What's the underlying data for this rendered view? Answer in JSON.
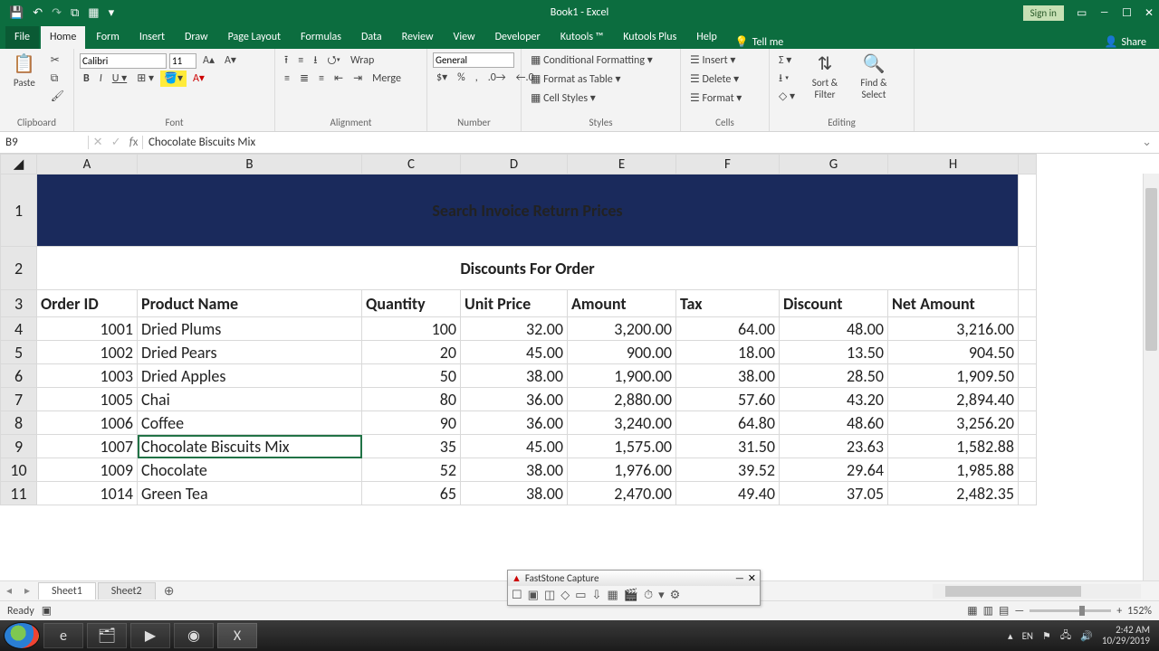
{
  "title": "Book1 - Excel",
  "qat_icons": [
    "save",
    "undo",
    "redo",
    "touch-mouse",
    "table-quick"
  ],
  "signin_label": "Sign in",
  "tabs": [
    "File",
    "Home",
    "Form",
    "Insert",
    "Draw",
    "Page Layout",
    "Formulas",
    "Data",
    "Review",
    "View",
    "Developer",
    "Kutools ™",
    "Kutools Plus",
    "Help"
  ],
  "active_tab": "Home",
  "tellme_label": "Tell me",
  "share_label": "Share",
  "ribbon": {
    "clipboard_label": "Clipboard",
    "paste_label": "Paste",
    "font_label": "Font",
    "font_name": "Calibri",
    "font_size": "11",
    "alignment_label": "Alignment",
    "wrap_label": "Wrap",
    "merge_label": "Merge",
    "number_label": "Number",
    "number_format": "General",
    "styles_label": "Styles",
    "cond_fmt": "Conditional Formatting",
    "fmt_table": "Format as Table",
    "cell_styles": "Cell Styles",
    "cells_label": "Cells",
    "insert": "Insert",
    "delete": "Delete",
    "format": "Format",
    "editing_label": "Editing",
    "sort_filter": "Sort & Filter",
    "find_select": "Find & Select"
  },
  "namebox": "B9",
  "formula_value": "Chocolate Biscuits Mix",
  "columns": [
    "A",
    "B",
    "C",
    "D",
    "E",
    "F",
    "G",
    "H"
  ],
  "banner_text": "Search Invoice Return Prices",
  "subtitle_text": "Discounts For Order",
  "headers": {
    "A": "Order ID",
    "B": "Product Name",
    "C": "Quantity",
    "D": "Unit Price",
    "E": "Amount",
    "F": "Tax",
    "G": "Discount",
    "H": "Net Amount"
  },
  "rows": [
    {
      "n": "4",
      "A": "1001",
      "B": "Dried Plums",
      "C": "100",
      "D": "32.00",
      "E": "3,200.00",
      "F": "64.00",
      "G": "48.00",
      "H": "3,216.00"
    },
    {
      "n": "5",
      "A": "1002",
      "B": "Dried Pears",
      "C": "20",
      "D": "45.00",
      "E": "900.00",
      "F": "18.00",
      "G": "13.50",
      "H": "904.50"
    },
    {
      "n": "6",
      "A": "1003",
      "B": "Dried Apples",
      "C": "50",
      "D": "38.00",
      "E": "1,900.00",
      "F": "38.00",
      "G": "28.50",
      "H": "1,909.50"
    },
    {
      "n": "7",
      "A": "1005",
      "B": "Chai",
      "C": "80",
      "D": "36.00",
      "E": "2,880.00",
      "F": "57.60",
      "G": "43.20",
      "H": "2,894.40"
    },
    {
      "n": "8",
      "A": "1006",
      "B": "Coffee",
      "C": "90",
      "D": "36.00",
      "E": "3,240.00",
      "F": "64.80",
      "G": "48.60",
      "H": "3,256.20"
    },
    {
      "n": "9",
      "A": "1007",
      "B": "Chocolate Biscuits Mix",
      "C": "35",
      "D": "45.00",
      "E": "1,575.00",
      "F": "31.50",
      "G": "23.63",
      "H": "1,582.88"
    },
    {
      "n": "10",
      "A": "1009",
      "B": "Chocolate",
      "C": "52",
      "D": "38.00",
      "E": "1,976.00",
      "F": "39.52",
      "G": "29.64",
      "H": "1,985.88"
    },
    {
      "n": "11",
      "A": "1014",
      "B": "Green Tea",
      "C": "65",
      "D": "38.00",
      "E": "2,470.00",
      "F": "49.40",
      "G": "37.05",
      "H": "2,482.35"
    }
  ],
  "sheet_tabs": [
    "Sheet1",
    "Sheet2"
  ],
  "active_sheet": "Sheet1",
  "status_ready": "Ready",
  "zoom": "152%",
  "faststone": {
    "title": "FastStone Capture"
  },
  "tray": {
    "lang": "EN",
    "time": "2:42 AM",
    "date": "10/29/2019"
  }
}
